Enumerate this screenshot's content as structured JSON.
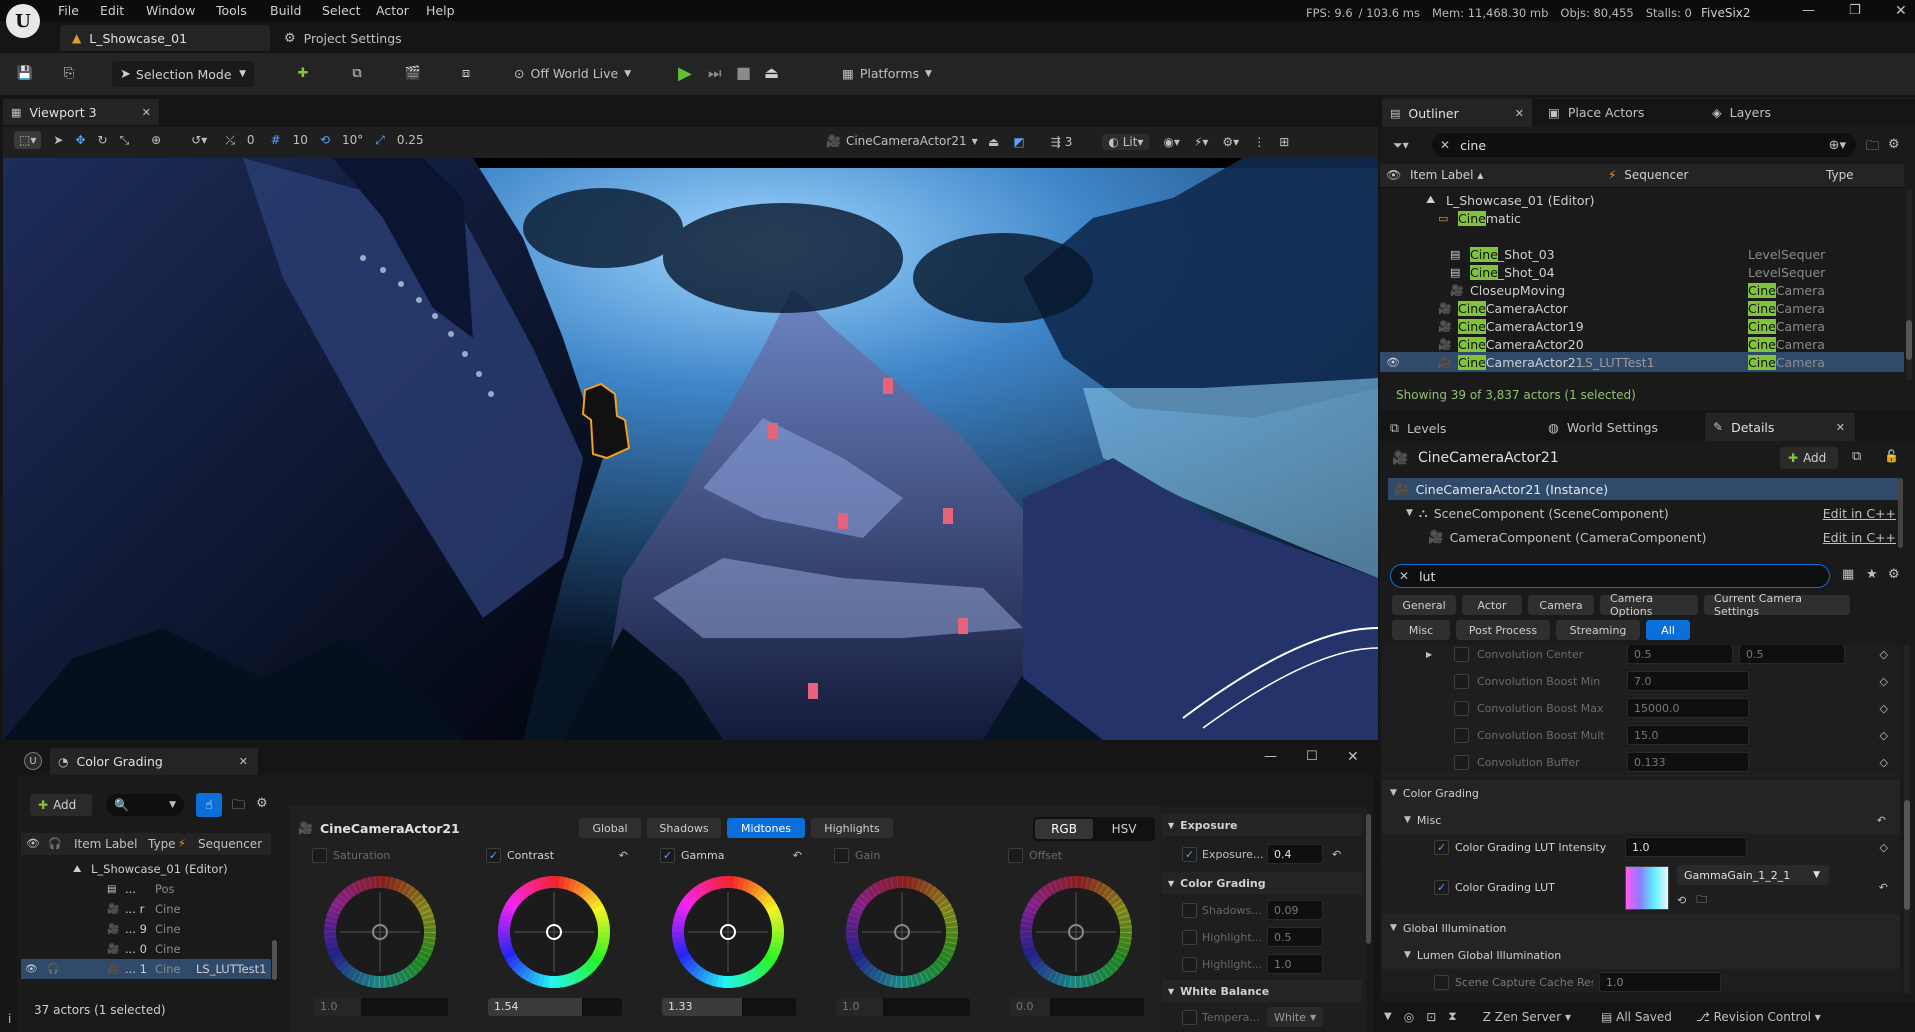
{
  "menu": {
    "items": [
      "File",
      "Edit",
      "Window",
      "Tools",
      "Build",
      "Select",
      "Actor",
      "Help"
    ]
  },
  "stats": {
    "fps": "FPS: 9.6",
    "ms": "/ 103.6 ms",
    "mem": "Mem: 11,468.30 mb",
    "objs": "Objs: 80,455",
    "stalls": "Stalls: 0",
    "project": "FiveSix2"
  },
  "tabs": {
    "level": "L_Showcase_01",
    "settings": "Project Settings"
  },
  "toolbar": {
    "mode": "Selection Mode",
    "live": "Off World Live",
    "platforms": "Platforms"
  },
  "viewport": {
    "tab": "Viewport 3",
    "rotate_snap_val": "0",
    "grid": "10",
    "angle": "10°",
    "scale": "0.25",
    "camera": "CineCameraActor21",
    "lit": "Lit",
    "layers": "3"
  },
  "outliner": {
    "tabs": [
      "Outliner",
      "Place Actors",
      "Layers"
    ],
    "search": "cine",
    "cols": {
      "label": "Item Label",
      "seq": "Sequencer",
      "type": "Type"
    },
    "rows": [
      {
        "pre": "",
        "hl": "",
        "post": "L_Showcase_01 (Editor)",
        "seq": "",
        "type": "",
        "indent": 40
      },
      {
        "pre": "",
        "hl": "Cine",
        "post": "matic",
        "seq": "",
        "type": "",
        "indent": 52
      },
      {
        "pre": "",
        "hl": "Cine",
        "post": "_Shot_03",
        "seq": "",
        "type": "LevelSequer",
        "indent": 64
      },
      {
        "pre": "",
        "hl": "Cine",
        "post": "_Shot_04",
        "seq": "",
        "type": "LevelSequer",
        "indent": 64
      },
      {
        "pre": "",
        "hl": "",
        "post": "CloseupMoving",
        "seq": "",
        "type": "Camera",
        "typehl": "Cine",
        "indent": 64
      },
      {
        "pre": "",
        "hl": "Cine",
        "post": "CameraActor",
        "seq": "",
        "type": "Camera",
        "typehl": "Cine",
        "indent": 52
      },
      {
        "pre": "",
        "hl": "Cine",
        "post": "CameraActor19",
        "seq": "",
        "type": "Camera",
        "typehl": "Cine",
        "indent": 52
      },
      {
        "pre": "",
        "hl": "Cine",
        "post": "CameraActor20",
        "seq": "",
        "type": "Camera",
        "typehl": "Cine",
        "indent": 52
      },
      {
        "pre": "",
        "hl": "Cine",
        "post": "CameraActor21",
        "seq": "LS_LUTTest1",
        "type": "Camera",
        "typehl": "Cine",
        "indent": 52
      }
    ],
    "status": "Showing 39 of 3,837 actors (1 selected)"
  },
  "details": {
    "tabs": [
      "Levels",
      "World Settings",
      "Details"
    ],
    "actor": "CineCameraActor21",
    "add": "Add",
    "instance": "CineCameraActor21 (Instance)",
    "comp1": "SceneComponent (SceneComponent)",
    "comp2": "CameraComponent (CameraComponent)",
    "editcpp": "Edit in C++",
    "search": "lut",
    "filters1": [
      "General",
      "Actor",
      "Camera",
      "Camera Options",
      "Current Camera Settings"
    ],
    "filters2": [
      "Misc",
      "Post Process",
      "Streaming",
      "All"
    ],
    "props": [
      {
        "label": "Convolution Center",
        "v1": "0.5",
        "v2": "0.5"
      },
      {
        "label": "Convolution Boost Min",
        "v1": "7.0"
      },
      {
        "label": "Convolution Boost Max",
        "v1": "15000.0"
      },
      {
        "label": "Convolution Boost Mult",
        "v1": "15.0"
      },
      {
        "label": "Convolution Buffer",
        "v1": "0.133"
      }
    ],
    "cg": "Color Grading",
    "misc": "Misc",
    "lut_int_label": "Color Grading LUT Intensity",
    "lut_int_val": "1.0",
    "lut_label": "Color Grading LUT",
    "lut_asset": "GammaGain_1_2_1",
    "gi": "Global Illumination",
    "lumen": "Lumen Global Illumination",
    "scene_cap": "Scene Capture Cache Resoluti...",
    "scene_cap_val": "1.0"
  },
  "statusbar": {
    "zen": "Zen Server",
    "saved": "All Saved",
    "rc": "Revision Control"
  },
  "cg_window": {
    "title": "Color Grading",
    "add": "Add",
    "cols": {
      "label": "Item Label",
      "type": "Type",
      "seq": "Sequencer"
    },
    "rows": [
      {
        "label": "L_Showcase_01 (Editor)",
        "type": "",
        "seq": ""
      },
      {
        "label": "...",
        "type": "Pos",
        "seq": ""
      },
      {
        "label": "... r",
        "type": "Cine",
        "seq": ""
      },
      {
        "label": "... 9",
        "type": "Cine",
        "seq": ""
      },
      {
        "label": "... 0",
        "type": "Cine",
        "seq": ""
      },
      {
        "label": "... 1",
        "type": "Cine",
        "seq": "LS_LUTTest1"
      }
    ],
    "status": "37 actors (1 selected)",
    "actor": "CineCameraActor21",
    "ranges": [
      "Global",
      "Shadows",
      "Midtones",
      "Highlights"
    ],
    "modes": [
      "RGB",
      "HSV"
    ],
    "wheels": [
      {
        "label": "Saturation",
        "val": "1.0",
        "checked": false,
        "fill": 0.35
      },
      {
        "label": "Contrast",
        "val": "1.54",
        "checked": true,
        "fill": 0.7
      },
      {
        "label": "Gamma",
        "val": "1.33",
        "checked": true,
        "fill": 0.6
      },
      {
        "label": "Gain",
        "val": "1.0",
        "checked": false,
        "fill": 0.35
      },
      {
        "label": "Offset",
        "val": "0.0",
        "checked": false,
        "fill": 0.3
      }
    ],
    "side": {
      "exposure": "Exposure",
      "exposure_label": "Exposure...",
      "exposure_val": "0.4",
      "cg": "Color Grading",
      "shadows": "Shadows...",
      "shadows_val": "0.09",
      "high1": "Highlight...",
      "high1_val": "0.5",
      "high2": "Highlight...",
      "high2_val": "1.0",
      "wb": "White Balance",
      "temp": "Tempera...",
      "temp_val": "White"
    }
  },
  "colors": {
    "accent": "#0a6fd9",
    "select": "#2f4a6b",
    "green": "#7fc43b",
    "bg": "#151515"
  }
}
